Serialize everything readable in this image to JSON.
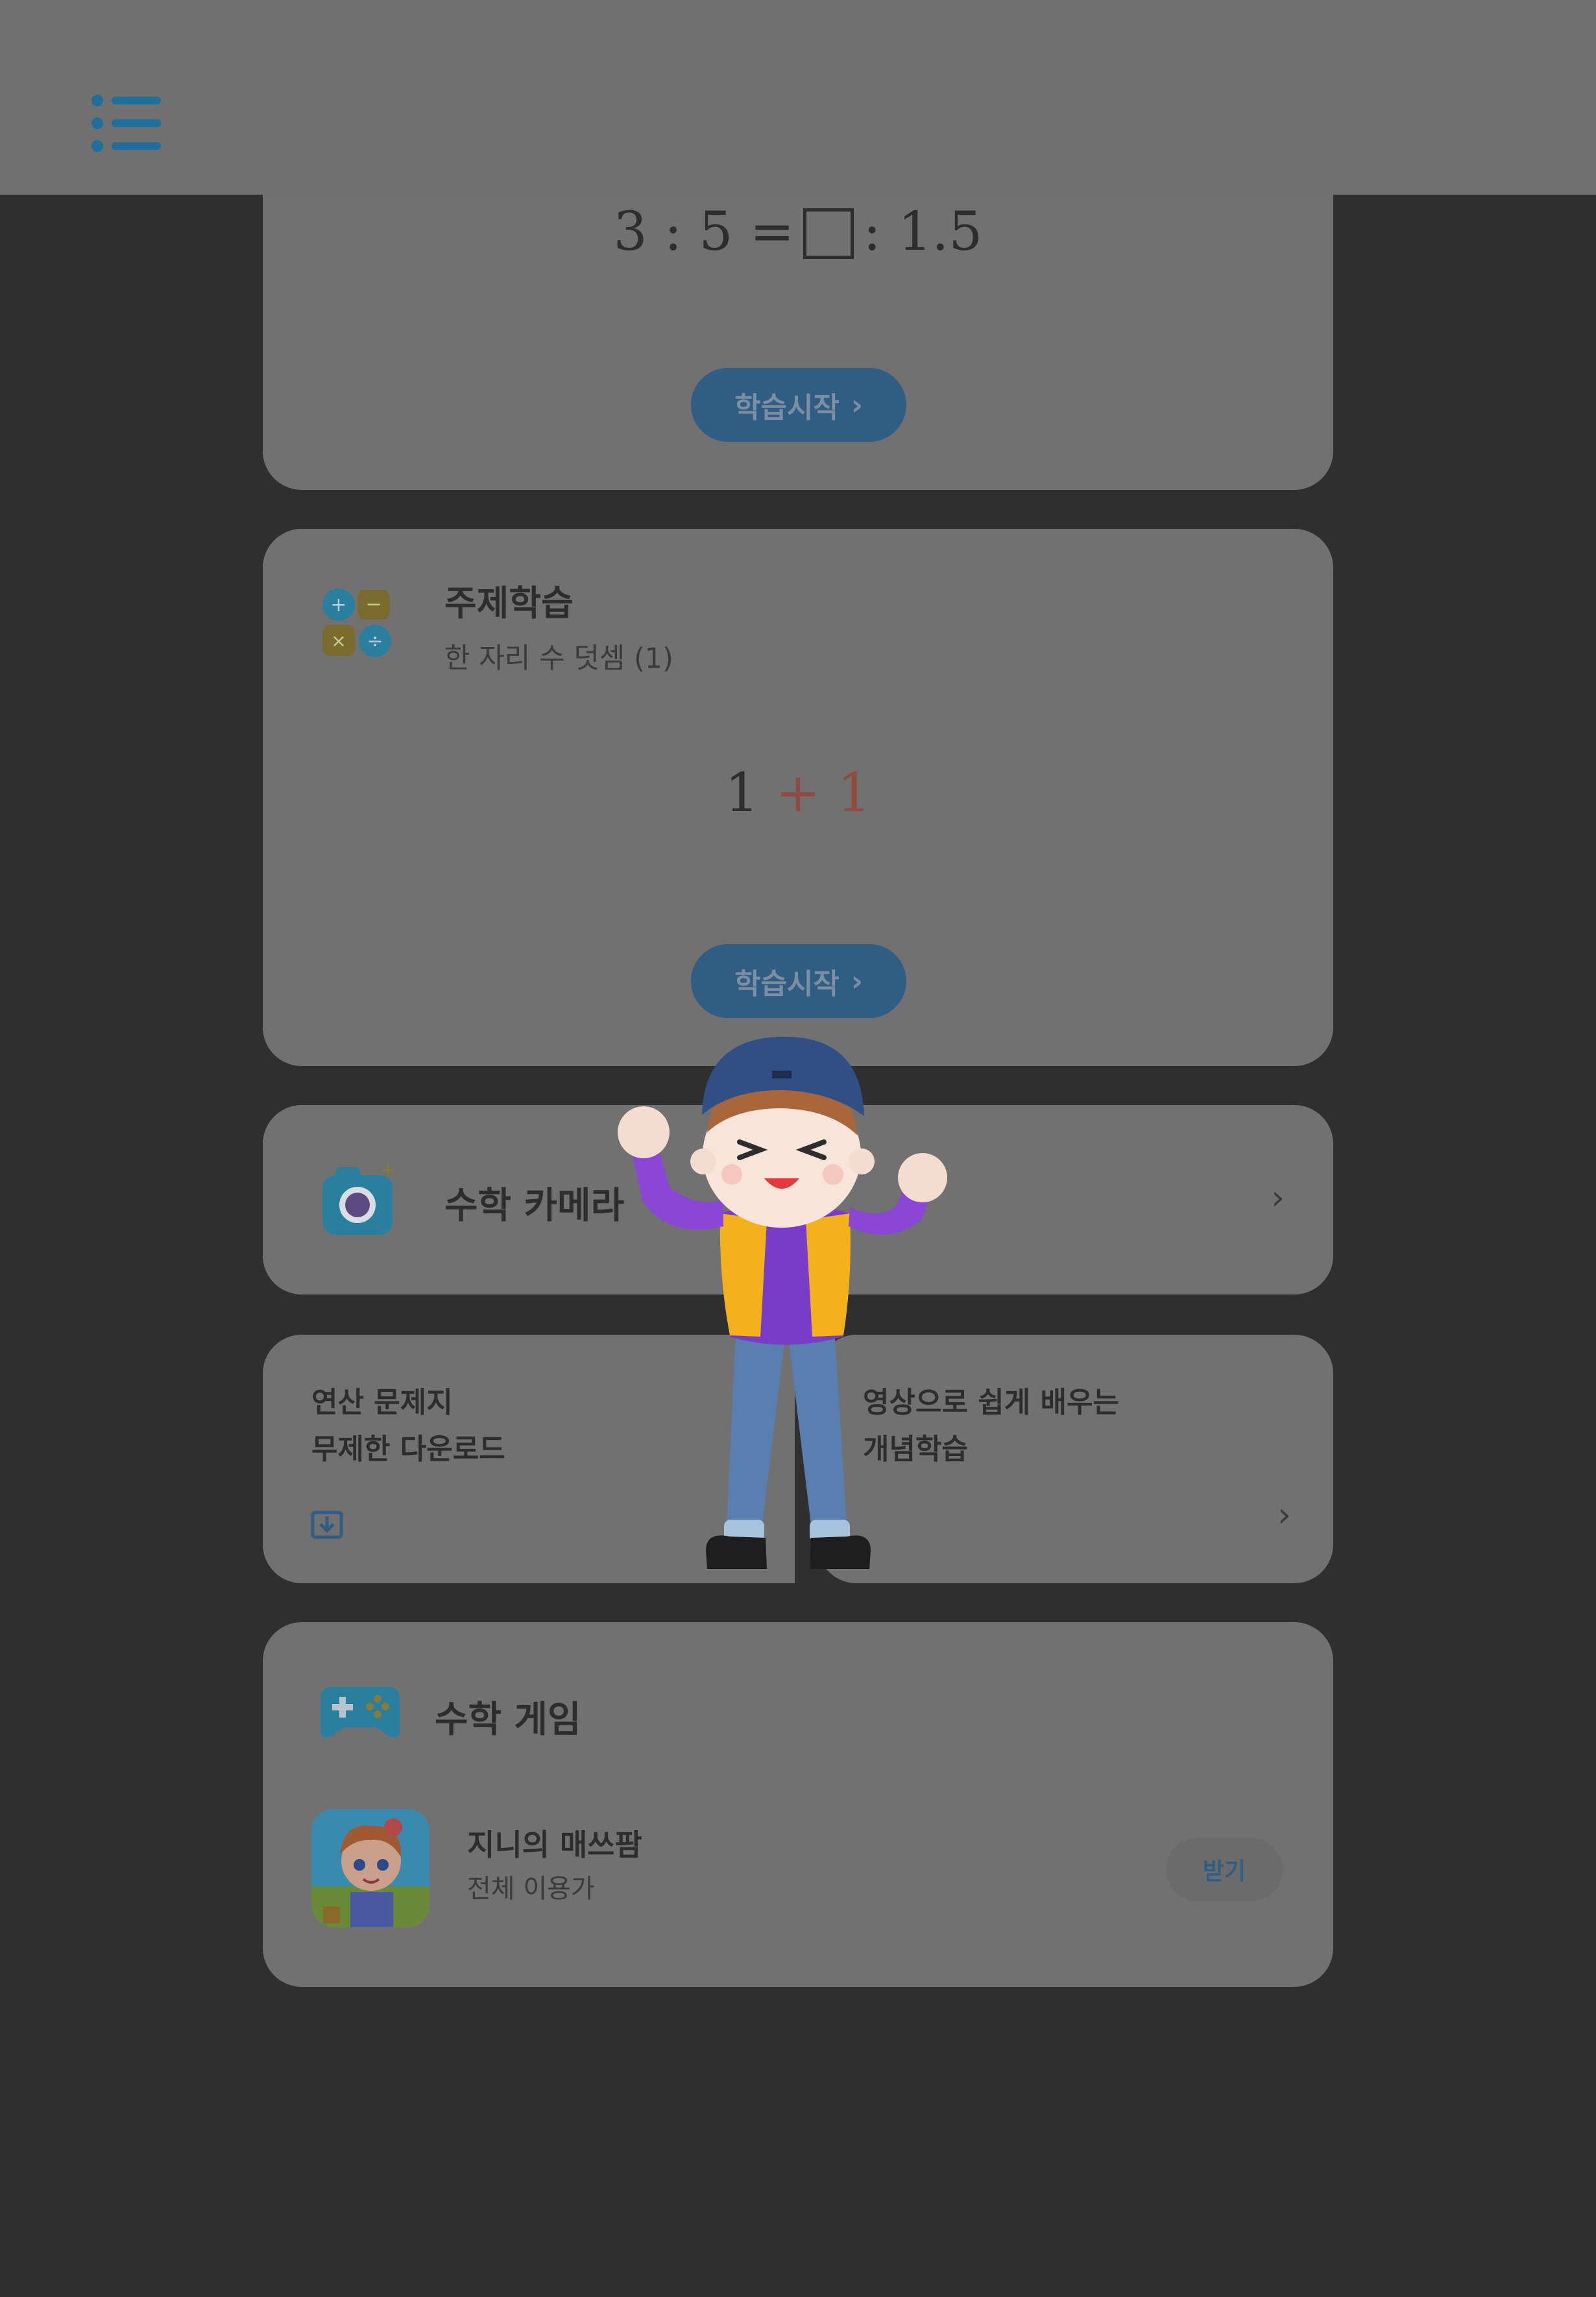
{
  "header": {
    "menu_icon": "list-menu-icon"
  },
  "ratio_card": {
    "formula": {
      "left": "3 : 5 =",
      "right": ": 1.5"
    },
    "start_label": "학습시작"
  },
  "topic_card": {
    "title": "주제학습",
    "subtitle": "한 자리 수 덧셈 (1)",
    "icon": "calculator-operations-icon",
    "formula": {
      "a": "1",
      "op": "+",
      "b": "1"
    },
    "start_label": "학습시작"
  },
  "camera_card": {
    "title": "수학 카메라",
    "icon": "camera-icon"
  },
  "worksheet_card": {
    "line1": "연산 문제지",
    "line2": "무제한 다운로드",
    "icon": "download-icon"
  },
  "video_card": {
    "line1": "영상으로 쉽게 배우는",
    "line2": "개념학습"
  },
  "games_card": {
    "title": "수학 게임",
    "icon": "gamepad-icon",
    "app": {
      "name": "지니의 매쓰팜",
      "rating": "전체 이용가",
      "get_label": "받기"
    }
  },
  "colors": {
    "accent": "#2f5d83",
    "card": "#717171",
    "background": "#2f2f2f",
    "topbar": "#707070"
  }
}
